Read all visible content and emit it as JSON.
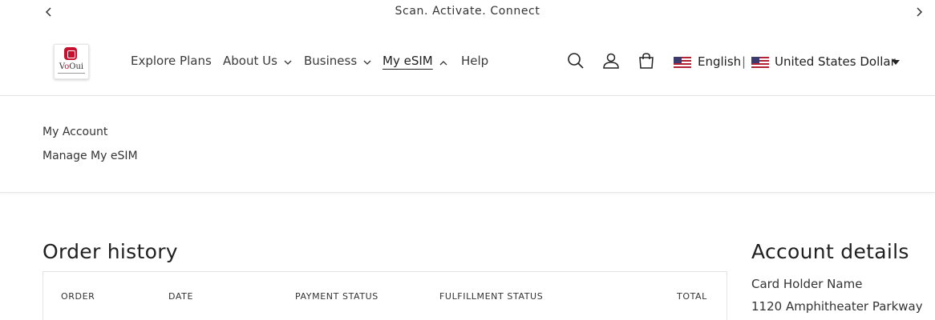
{
  "announcement": {
    "text": "Scan. Activate. Connect"
  },
  "header": {
    "logo": {
      "brand_prefix": "V",
      "brand_mark": "o",
      "brand_suffix": "Oui"
    },
    "nav": [
      {
        "label": "Explore Plans",
        "dropdown": false
      },
      {
        "label": "About Us",
        "dropdown": true
      },
      {
        "label": "Business",
        "dropdown": true
      },
      {
        "label": "My eSIM",
        "dropdown": true,
        "expanded": true,
        "active": true
      },
      {
        "label": "Help",
        "dropdown": false
      }
    ],
    "icons": [
      "search-icon",
      "account-icon",
      "cart-icon"
    ],
    "locale": {
      "language": "English",
      "separator": "|",
      "currency": "United States Dollar",
      "flag": "us-flag-icon"
    }
  },
  "submenu": {
    "items": [
      "My Account",
      "Manage My eSIM"
    ]
  },
  "orders": {
    "title": "Order history",
    "columns": [
      "ORDER",
      "DATE",
      "PAYMENT STATUS",
      "FULFILLMENT STATUS",
      "TOTAL"
    ]
  },
  "account": {
    "title": "Account details",
    "name": "Card Holder Name",
    "address_partial": "1120 Amphitheater Parkway"
  },
  "colors": {
    "brand": "#c8102e",
    "text": "#202020",
    "border": "#e3e3e3"
  }
}
